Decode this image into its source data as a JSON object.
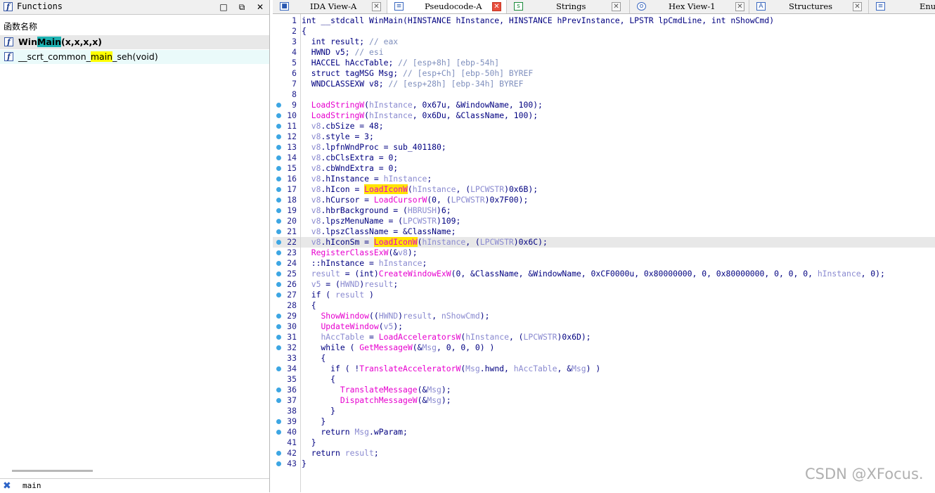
{
  "colors": {
    "keyword_normal": "#000080",
    "comment": "#7f8fbd",
    "function_name": "#e700cf",
    "variable": "#8a8ad0",
    "highlight": "#ffe400",
    "active_tab_close": "#e84e3c",
    "row_highlight_cyan": "#1fb3b3"
  },
  "functions_panel": {
    "title": "Functions",
    "column_header": "函数名称",
    "rows": [
      {
        "pre": "",
        "hl": "Win",
        "hl2": "Main",
        "post": "(x,x,x,x)"
      },
      {
        "pre": "__scrt_common_",
        "hl": "main",
        "post": "_seh(void)"
      }
    ],
    "filter_text": "main"
  },
  "tabs": [
    {
      "label": "IDA View-A",
      "icon": "graph-view-icon"
    },
    {
      "label": "Pseudocode-A",
      "icon": "pseudocode-icon"
    },
    {
      "label": "Strings",
      "icon": "strings-icon"
    },
    {
      "label": "Hex View-1",
      "icon": "hex-view-icon"
    },
    {
      "label": "Structures",
      "icon": "structures-icon"
    },
    {
      "label": "Enum",
      "icon": "enums-icon"
    }
  ],
  "code_lines": [
    {
      "n": "1",
      "bp": false,
      "t": [
        [
          "n",
          "int __stdcall WinMain(HINSTANCE hInstance, HINSTANCE hPrevInstance, LPSTR lpCmdLine, int nShowCmd)"
        ]
      ]
    },
    {
      "n": "2",
      "bp": false,
      "t": [
        [
          "n",
          "{"
        ]
      ]
    },
    {
      "n": "3",
      "bp": false,
      "t": [
        [
          "n",
          "  int result; "
        ],
        [
          "c",
          "// eax"
        ]
      ]
    },
    {
      "n": "4",
      "bp": false,
      "t": [
        [
          "n",
          "  HWND v5; "
        ],
        [
          "c",
          "// esi"
        ]
      ]
    },
    {
      "n": "5",
      "bp": false,
      "t": [
        [
          "n",
          "  HACCEL hAccTable; "
        ],
        [
          "c",
          "// [esp+8h] [ebp-54h]"
        ]
      ]
    },
    {
      "n": "6",
      "bp": false,
      "t": [
        [
          "n",
          "  struct tagMSG Msg; "
        ],
        [
          "c",
          "// [esp+Ch] [ebp-50h] BYREF"
        ]
      ]
    },
    {
      "n": "7",
      "bp": false,
      "t": [
        [
          "n",
          "  WNDCLASSEXW v8; "
        ],
        [
          "c",
          "// [esp+28h] [ebp-34h] BYREF"
        ]
      ]
    },
    {
      "n": "8",
      "bp": false,
      "t": [
        [
          "n",
          ""
        ]
      ]
    },
    {
      "n": "9",
      "bp": true,
      "t": [
        [
          "n",
          "  "
        ],
        [
          "f",
          "LoadStringW"
        ],
        [
          "n",
          "("
        ],
        [
          "v",
          "hInstance"
        ],
        [
          "n",
          ", 0x67u, &WindowName, 100);"
        ]
      ]
    },
    {
      "n": "10",
      "bp": true,
      "t": [
        [
          "n",
          "  "
        ],
        [
          "f",
          "LoadStringW"
        ],
        [
          "n",
          "("
        ],
        [
          "v",
          "hInstance"
        ],
        [
          "n",
          ", 0x6Du, &ClassName, 100);"
        ]
      ]
    },
    {
      "n": "11",
      "bp": true,
      "t": [
        [
          "n",
          "  "
        ],
        [
          "v",
          "v8"
        ],
        [
          "n",
          ".cbSize = 48;"
        ]
      ]
    },
    {
      "n": "12",
      "bp": true,
      "t": [
        [
          "n",
          "  "
        ],
        [
          "v",
          "v8"
        ],
        [
          "n",
          ".style = 3;"
        ]
      ]
    },
    {
      "n": "13",
      "bp": true,
      "t": [
        [
          "n",
          "  "
        ],
        [
          "v",
          "v8"
        ],
        [
          "n",
          ".lpfnWndProc = sub_401180;"
        ]
      ]
    },
    {
      "n": "14",
      "bp": true,
      "t": [
        [
          "n",
          "  "
        ],
        [
          "v",
          "v8"
        ],
        [
          "n",
          ".cbClsExtra = 0;"
        ]
      ]
    },
    {
      "n": "15",
      "bp": true,
      "t": [
        [
          "n",
          "  "
        ],
        [
          "v",
          "v8"
        ],
        [
          "n",
          ".cbWndExtra = 0;"
        ]
      ]
    },
    {
      "n": "16",
      "bp": true,
      "t": [
        [
          "n",
          "  "
        ],
        [
          "v",
          "v8"
        ],
        [
          "n",
          ".hInstance = "
        ],
        [
          "v",
          "hInstance"
        ],
        [
          "n",
          ";"
        ]
      ]
    },
    {
      "n": "17",
      "bp": true,
      "t": [
        [
          "n",
          "  "
        ],
        [
          "v",
          "v8"
        ],
        [
          "n",
          ".hIcon = "
        ],
        [
          "h",
          "LoadIconW"
        ],
        [
          "n",
          "("
        ],
        [
          "v",
          "hInstance"
        ],
        [
          "n",
          ", ("
        ],
        [
          "v",
          "LPCWSTR"
        ],
        [
          "n",
          ")0x6B);"
        ]
      ]
    },
    {
      "n": "18",
      "bp": true,
      "t": [
        [
          "n",
          "  "
        ],
        [
          "v",
          "v8"
        ],
        [
          "n",
          ".hCursor = "
        ],
        [
          "f",
          "LoadCursorW"
        ],
        [
          "n",
          "(0, ("
        ],
        [
          "v",
          "LPCWSTR"
        ],
        [
          "n",
          ")0x7F00);"
        ]
      ]
    },
    {
      "n": "19",
      "bp": true,
      "t": [
        [
          "n",
          "  "
        ],
        [
          "v",
          "v8"
        ],
        [
          "n",
          ".hbrBackground = ("
        ],
        [
          "v",
          "HBRUSH"
        ],
        [
          "n",
          ")6;"
        ]
      ]
    },
    {
      "n": "20",
      "bp": true,
      "t": [
        [
          "n",
          "  "
        ],
        [
          "v",
          "v8"
        ],
        [
          "n",
          ".lpszMenuName = ("
        ],
        [
          "v",
          "LPCWSTR"
        ],
        [
          "n",
          ")109;"
        ]
      ]
    },
    {
      "n": "21",
      "bp": true,
      "t": [
        [
          "n",
          "  "
        ],
        [
          "v",
          "v8"
        ],
        [
          "n",
          ".lpszClassName = &ClassName;"
        ]
      ]
    },
    {
      "n": "22",
      "bp": true,
      "cur": true,
      "t": [
        [
          "n",
          "  "
        ],
        [
          "v",
          "v8"
        ],
        [
          "n",
          ".hIconSm = "
        ],
        [
          "h",
          "LoadIconW"
        ],
        [
          "n",
          "("
        ],
        [
          "v",
          "hInstance"
        ],
        [
          "n",
          ", ("
        ],
        [
          "v",
          "LPCWSTR"
        ],
        [
          "n",
          ")0x6C);"
        ]
      ]
    },
    {
      "n": "23",
      "bp": true,
      "t": [
        [
          "n",
          "  "
        ],
        [
          "f",
          "RegisterClassExW"
        ],
        [
          "n",
          "(&"
        ],
        [
          "v",
          "v8"
        ],
        [
          "n",
          ");"
        ]
      ]
    },
    {
      "n": "24",
      "bp": true,
      "t": [
        [
          "n",
          "  ::hInstance = "
        ],
        [
          "v",
          "hInstance"
        ],
        [
          "n",
          ";"
        ]
      ]
    },
    {
      "n": "25",
      "bp": true,
      "t": [
        [
          "n",
          "  "
        ],
        [
          "v",
          "result"
        ],
        [
          "n",
          " = (int)"
        ],
        [
          "f",
          "CreateWindowExW"
        ],
        [
          "n",
          "(0, &ClassName, &WindowName, 0xCF0000u, 0x80000000, 0, 0x80000000, 0, 0, 0, "
        ],
        [
          "v",
          "hInstance"
        ],
        [
          "n",
          ", 0);"
        ]
      ]
    },
    {
      "n": "26",
      "bp": true,
      "t": [
        [
          "n",
          "  "
        ],
        [
          "v",
          "v5"
        ],
        [
          "n",
          " = ("
        ],
        [
          "v",
          "HWND"
        ],
        [
          "n",
          ")"
        ],
        [
          "v",
          "result"
        ],
        [
          "n",
          ";"
        ]
      ]
    },
    {
      "n": "27",
      "bp": true,
      "t": [
        [
          "n",
          "  if ( "
        ],
        [
          "v",
          "result"
        ],
        [
          "n",
          " )"
        ]
      ]
    },
    {
      "n": "28",
      "bp": false,
      "t": [
        [
          "n",
          "  {"
        ]
      ]
    },
    {
      "n": "29",
      "bp": true,
      "t": [
        [
          "n",
          "    "
        ],
        [
          "f",
          "ShowWindow"
        ],
        [
          "n",
          "(("
        ],
        [
          "v",
          "HWND"
        ],
        [
          "n",
          ")"
        ],
        [
          "v",
          "result"
        ],
        [
          "n",
          ", "
        ],
        [
          "v",
          "nShowCmd"
        ],
        [
          "n",
          ");"
        ]
      ]
    },
    {
      "n": "30",
      "bp": true,
      "t": [
        [
          "n",
          "    "
        ],
        [
          "f",
          "UpdateWindow"
        ],
        [
          "n",
          "("
        ],
        [
          "v",
          "v5"
        ],
        [
          "n",
          ");"
        ]
      ]
    },
    {
      "n": "31",
      "bp": true,
      "t": [
        [
          "n",
          "    "
        ],
        [
          "v",
          "hAccTable"
        ],
        [
          "n",
          " = "
        ],
        [
          "f",
          "LoadAcceleratorsW"
        ],
        [
          "n",
          "("
        ],
        [
          "v",
          "hInstance"
        ],
        [
          "n",
          ", ("
        ],
        [
          "v",
          "LPCWSTR"
        ],
        [
          "n",
          ")0x6D);"
        ]
      ]
    },
    {
      "n": "32",
      "bp": true,
      "t": [
        [
          "n",
          "    while ( "
        ],
        [
          "f",
          "GetMessageW"
        ],
        [
          "n",
          "(&"
        ],
        [
          "v",
          "Msg"
        ],
        [
          "n",
          ", 0, 0, 0) )"
        ]
      ]
    },
    {
      "n": "33",
      "bp": false,
      "t": [
        [
          "n",
          "    {"
        ]
      ]
    },
    {
      "n": "34",
      "bp": true,
      "t": [
        [
          "n",
          "      if ( !"
        ],
        [
          "f",
          "TranslateAcceleratorW"
        ],
        [
          "n",
          "("
        ],
        [
          "v",
          "Msg"
        ],
        [
          "n",
          ".hwnd, "
        ],
        [
          "v",
          "hAccTable"
        ],
        [
          "n",
          ", &"
        ],
        [
          "v",
          "Msg"
        ],
        [
          "n",
          ") )"
        ]
      ]
    },
    {
      "n": "35",
      "bp": false,
      "t": [
        [
          "n",
          "      {"
        ]
      ]
    },
    {
      "n": "36",
      "bp": true,
      "t": [
        [
          "n",
          "        "
        ],
        [
          "f",
          "TranslateMessage"
        ],
        [
          "n",
          "(&"
        ],
        [
          "v",
          "Msg"
        ],
        [
          "n",
          ");"
        ]
      ]
    },
    {
      "n": "37",
      "bp": true,
      "t": [
        [
          "n",
          "        "
        ],
        [
          "f",
          "DispatchMessageW"
        ],
        [
          "n",
          "(&"
        ],
        [
          "v",
          "Msg"
        ],
        [
          "n",
          ");"
        ]
      ]
    },
    {
      "n": "38",
      "bp": false,
      "t": [
        [
          "n",
          "      }"
        ]
      ]
    },
    {
      "n": "39",
      "bp": true,
      "t": [
        [
          "n",
          "    }"
        ]
      ]
    },
    {
      "n": "40",
      "bp": true,
      "t": [
        [
          "n",
          "    return "
        ],
        [
          "v",
          "Msg"
        ],
        [
          "n",
          ".wParam;"
        ]
      ]
    },
    {
      "n": "41",
      "bp": false,
      "t": [
        [
          "n",
          "  }"
        ]
      ]
    },
    {
      "n": "42",
      "bp": true,
      "t": [
        [
          "n",
          "  return "
        ],
        [
          "v",
          "result"
        ],
        [
          "n",
          ";"
        ]
      ]
    },
    {
      "n": "43",
      "bp": true,
      "t": [
        [
          "n",
          "}"
        ]
      ]
    }
  ],
  "watermark": "CSDN @XFocus."
}
